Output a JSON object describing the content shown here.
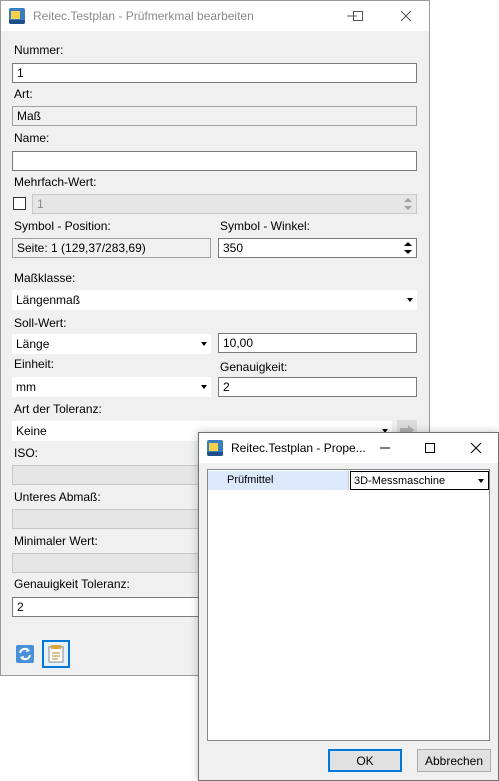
{
  "main_window": {
    "title": "Reitec.Testplan - Prüfmerkmal bearbeiten",
    "nummer_label": "Nummer:",
    "nummer_value": "1",
    "art_label": "Art:",
    "art_value": "Maß",
    "name_label": "Name:",
    "name_value": "",
    "mehrfach_label": "Mehrfach-Wert:",
    "mehrfach_checked": false,
    "mehrfach_value": "1",
    "symbol_position_label": "Symbol - Position:",
    "symbol_position_value": "Seite: 1 (129,37/283,69)",
    "symbol_winkel_label": "Symbol - Winkel:",
    "symbol_winkel_value": "350",
    "massklasse_label": "Maßklasse:",
    "massklasse_value": "Längenmaß",
    "sollwert_label": "Soll-Wert:",
    "sollwert_type": "Länge",
    "sollwert_value": "10,00",
    "einheit_label": "Einheit:",
    "einheit_value": "mm",
    "genauigkeit_label": "Genauigkeit:",
    "genauigkeit_value": "2",
    "toleranz_label": "Art der Toleranz:",
    "toleranz_value": "Keine",
    "iso_label": "ISO:",
    "unteres_label": "Unteres Abmaß:",
    "minimal_label": "Minimaler Wert:",
    "genauigkeit_tol_label": "Genauigkeit Toleranz:",
    "genauigkeit_tol_value": "2"
  },
  "dialog": {
    "title": "Reitec.Testplan - Prope...",
    "property_name": "Prüfmittel",
    "property_value": "3D-Messmaschine",
    "ok_label": "OK",
    "cancel_label": "Abbrechen"
  },
  "icons": {
    "refresh": "refresh-icon",
    "properties": "properties-icon",
    "arrow": "arrow-right-icon"
  },
  "colors": {
    "window_bg": "#f0f0f0",
    "selection": "#dce8fb",
    "focus_border": "#0078d7"
  }
}
